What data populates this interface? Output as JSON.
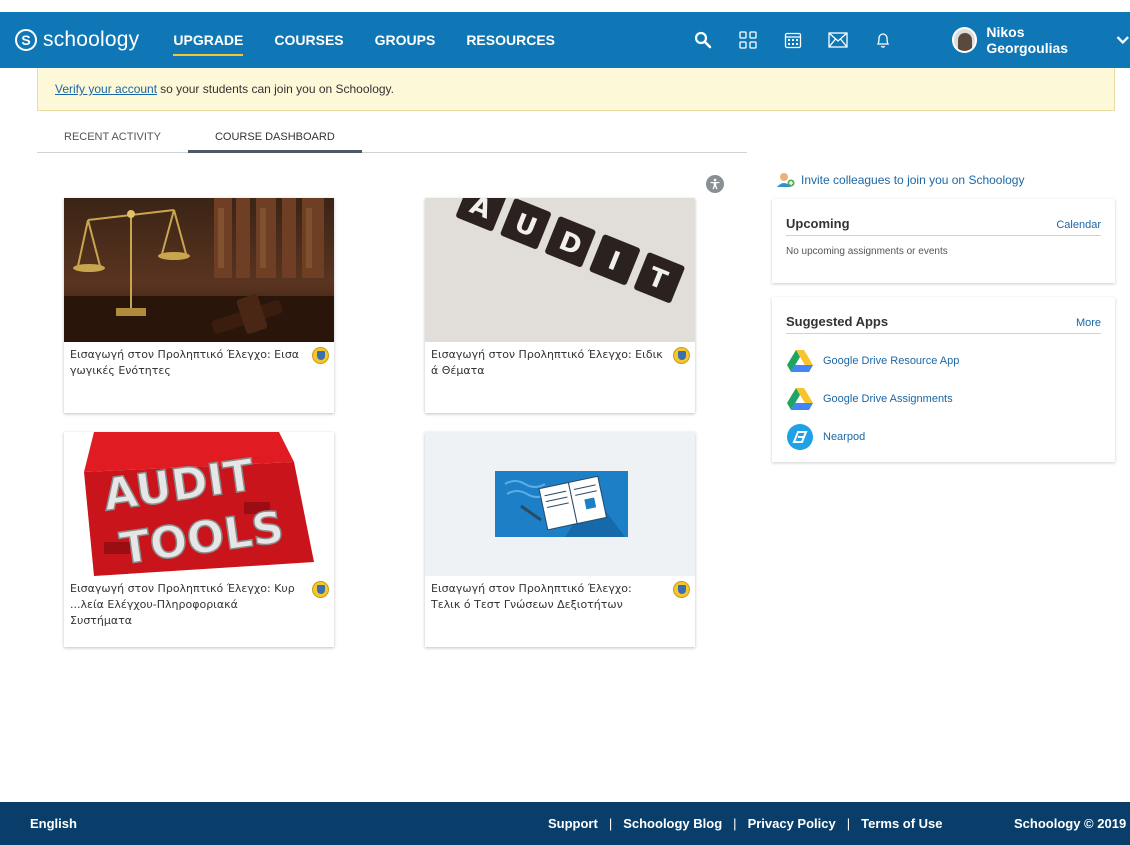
{
  "header": {
    "logo_text": "schoology",
    "nav": [
      {
        "label": "UPGRADE"
      },
      {
        "label": "COURSES"
      },
      {
        "label": "GROUPS"
      },
      {
        "label": "RESOURCES"
      }
    ],
    "user_name": "Nikos Georgoulias",
    "icons": [
      "search-icon",
      "apps-grid-icon",
      "calendar-icon",
      "mail-icon",
      "bell-icon"
    ]
  },
  "banner": {
    "link_text": "Verify your account",
    "text": "so your students can join you on Schoology."
  },
  "tabs": [
    {
      "label": "RECENT ACTIVITY",
      "active": false
    },
    {
      "label": "COURSE DASHBOARD",
      "active": true
    }
  ],
  "courses": [
    {
      "title": "Εισαγωγή στον Προληπτικό Έλεγχο: Εισα γωγικές Ενότητες",
      "image": "scales-of-justice"
    },
    {
      "title": "Εισαγωγή στον Προληπτικό Έλεγχο: Ειδικ ά Θέματα",
      "image": "audit-tiles"
    },
    {
      "title": "Εισαγωγή στον Προληπτικό Έλεγχο: Κυρ ...λεία Ελέγχου-Πληροφοριακά Συστήματα",
      "image": "audit-tools-toolbox"
    },
    {
      "title": "Εισαγωγή στον Προληπτικό Έλεγχο: Τελικ ό Τεστ Γνώσεων Δεξιοτήτων",
      "image": "default-book"
    }
  ],
  "sidebar": {
    "invite_text": "Invite colleagues to join you on Schoology",
    "upcoming": {
      "title": "Upcoming",
      "link": "Calendar",
      "empty_text": "No upcoming assignments or events"
    },
    "apps": {
      "title": "Suggested Apps",
      "link": "More",
      "items": [
        {
          "label": "Google Drive Resource App",
          "icon": "google-drive-icon"
        },
        {
          "label": "Google Drive Assignments",
          "icon": "google-drive-icon"
        },
        {
          "label": "Nearpod",
          "icon": "nearpod-icon"
        }
      ]
    }
  },
  "footer": {
    "language": "English",
    "links": [
      "Support",
      "Schoology Blog",
      "Privacy Policy",
      "Terms of Use"
    ],
    "separator": "|",
    "copyright": "Schoology © 2019"
  },
  "colors": {
    "header_bg": "#0f77b6",
    "footer_bg": "#0a3e6a",
    "link": "#1b67a5",
    "banner_bg": "#fdf8d8",
    "active_underline": "#f6c62d"
  }
}
